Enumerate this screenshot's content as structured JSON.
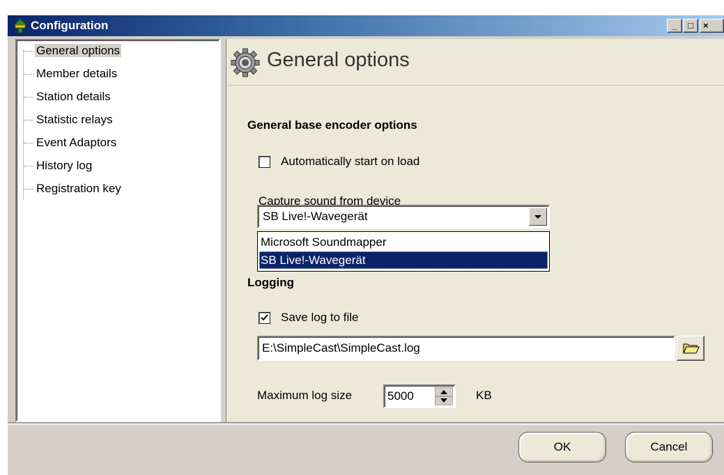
{
  "window": {
    "title": "Configuration",
    "controls": {
      "minimize": "_",
      "maximize": "□",
      "close": "×"
    }
  },
  "tree": {
    "items": [
      {
        "label": "General options",
        "selected": true
      },
      {
        "label": "Member details"
      },
      {
        "label": "Station details"
      },
      {
        "label": "Statistic relays"
      },
      {
        "label": "Event Adaptors"
      },
      {
        "label": "History log"
      },
      {
        "label": "Registration key"
      }
    ]
  },
  "header": {
    "title": "General options",
    "icon": "gear-icon"
  },
  "encoder_section": {
    "title": "General base encoder options",
    "autostart": {
      "label": "Automatically start on load",
      "checked": false
    },
    "capture": {
      "label": "Capture sound from device",
      "selected": "SB Live!-Wavegerät",
      "options": [
        "Microsoft Soundmapper",
        "SB Live!-Wavegerät"
      ],
      "highlighted": "SB Live!-Wavegerät"
    }
  },
  "logging_section": {
    "title": "Logging",
    "save_log": {
      "label": "Save log to file",
      "checked": true
    },
    "log_path": "E:\\SimpleCast\\SimpleCast.log",
    "max_size": {
      "label": "Maximum log size",
      "value": "5000",
      "unit": "KB"
    }
  },
  "buttons": {
    "ok": "OK",
    "cancel": "Cancel"
  },
  "colors": {
    "titlebar_start": "#0a246a",
    "titlebar_end": "#a6caf0",
    "selection": "#0a246a",
    "panel": "#ece9d8",
    "frame": "#d4d0c8"
  }
}
